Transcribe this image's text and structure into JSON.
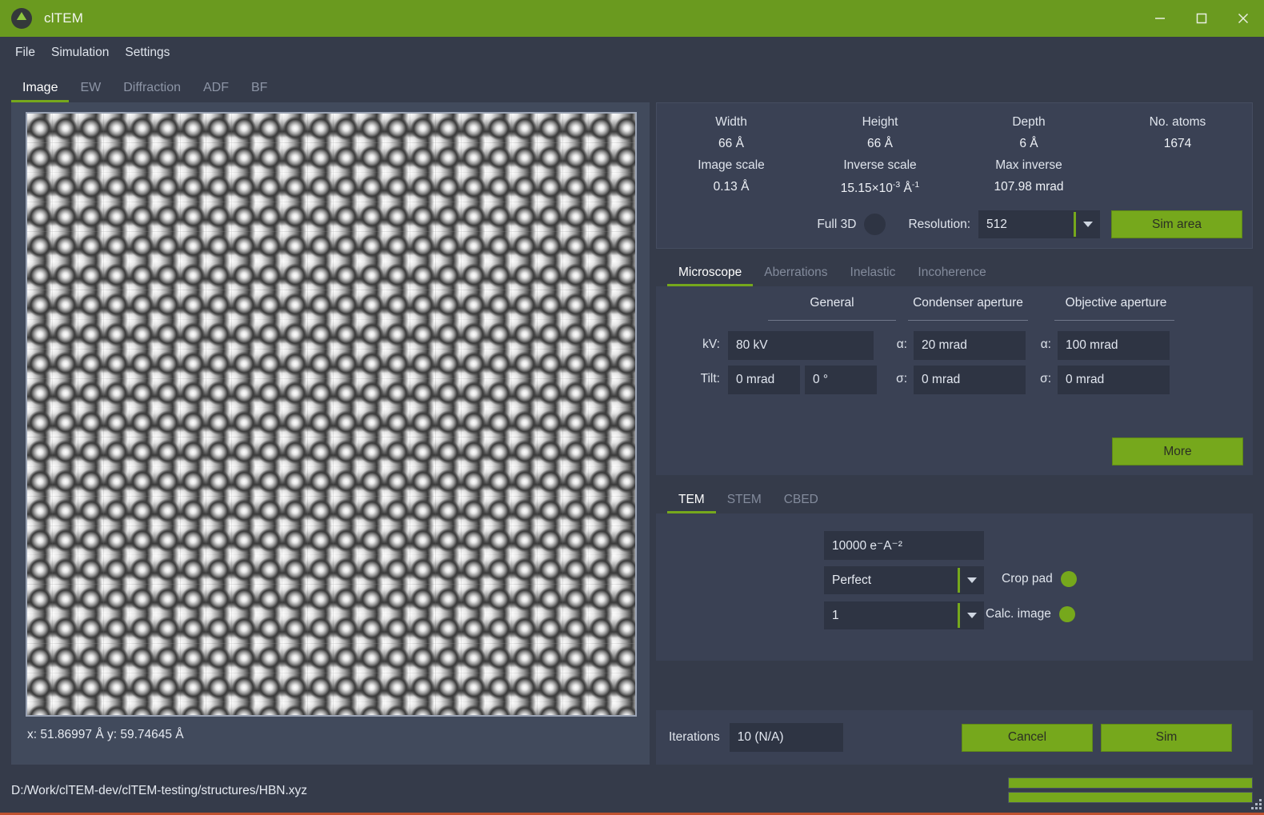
{
  "window": {
    "title": "clTEM",
    "app_icon": "lens-triangle-icon",
    "minimize": "minimize-icon",
    "maximize": "maximize-icon",
    "close": "close-icon"
  },
  "menubar": {
    "items": [
      "File",
      "Simulation",
      "Settings"
    ]
  },
  "tabs": {
    "items": [
      {
        "label": "Image",
        "active": true
      },
      {
        "label": "EW",
        "active": false
      },
      {
        "label": "Diffraction",
        "active": false
      },
      {
        "label": "ADF",
        "active": false
      },
      {
        "label": "BF",
        "active": false
      }
    ]
  },
  "image_panel": {
    "coords": "x: 51.86997 Å  y: 59.74645 Å"
  },
  "info": {
    "row1": [
      {
        "label": "Width",
        "value": "66 Å"
      },
      {
        "label": "Height",
        "value": "66 Å"
      },
      {
        "label": "Depth",
        "value": "6 Å"
      },
      {
        "label": "No. atoms",
        "value": "1674"
      }
    ],
    "row2": [
      {
        "label": "Image scale",
        "value": "0.13 Å"
      },
      {
        "label": "Inverse scale",
        "value_pre": "15.15×10",
        "value_sup": "-3",
        "value_post": " Å",
        "value_post_sup": "-1"
      },
      {
        "label": "Max inverse",
        "value": "107.98 mrad"
      },
      {
        "label": "",
        "value": ""
      }
    ],
    "full3d_label": "Full 3D",
    "full3d_state": "off",
    "resolution_label": "Resolution:",
    "resolution_value": "512",
    "sim_area_button": "Sim area"
  },
  "microscope": {
    "tabs": [
      {
        "label": "Microscope",
        "active": true
      },
      {
        "label": "Aberrations",
        "active": false
      },
      {
        "label": "Inelastic",
        "active": false
      },
      {
        "label": "Incoherence",
        "active": false
      }
    ],
    "headers": {
      "general": "General",
      "condenser": "Condenser aperture",
      "objective": "Objective aperture"
    },
    "fields": {
      "kv_label": "kV:",
      "kv_value": "80 kV",
      "tilt_label": "Tilt:",
      "tilt_mrad": "0 mrad",
      "tilt_deg": "0 °",
      "cond_alpha_label": "α:",
      "cond_alpha_value": "20 mrad",
      "cond_sigma_label": "σ:",
      "cond_sigma_value": "0 mrad",
      "obj_alpha_label": "α:",
      "obj_alpha_value": "100 mrad",
      "obj_sigma_label": "σ:",
      "obj_sigma_value": "0 mrad"
    },
    "more_button": "More"
  },
  "mode": {
    "tabs": [
      {
        "label": "TEM",
        "active": true
      },
      {
        "label": "STEM",
        "active": false
      },
      {
        "label": "CBED",
        "active": false
      }
    ],
    "dose_value": "10000 e⁻A⁻²",
    "ccd_value": "Perfect",
    "binning_value": "1",
    "crop_pad_label": "Crop pad",
    "crop_pad_state": "on",
    "calc_image_label": "Calc. image",
    "calc_image_state": "on"
  },
  "iterations": {
    "label": "Iterations",
    "value": "10 (N/A)",
    "cancel_button": "Cancel",
    "sim_button": "Sim"
  },
  "status": {
    "path": "D:/Work/clTEM-dev/clTEM-testing/structures/HBN.xyz",
    "progress_1": 100,
    "progress_2": 100
  },
  "colors": {
    "accent_green": "#76a81c",
    "titlebar_green": "#6a9a1f",
    "panel_bg": "#3a4154",
    "window_bg": "#353b4a",
    "field_bg": "#2e3443",
    "bottom_edge": "#c0522f"
  }
}
